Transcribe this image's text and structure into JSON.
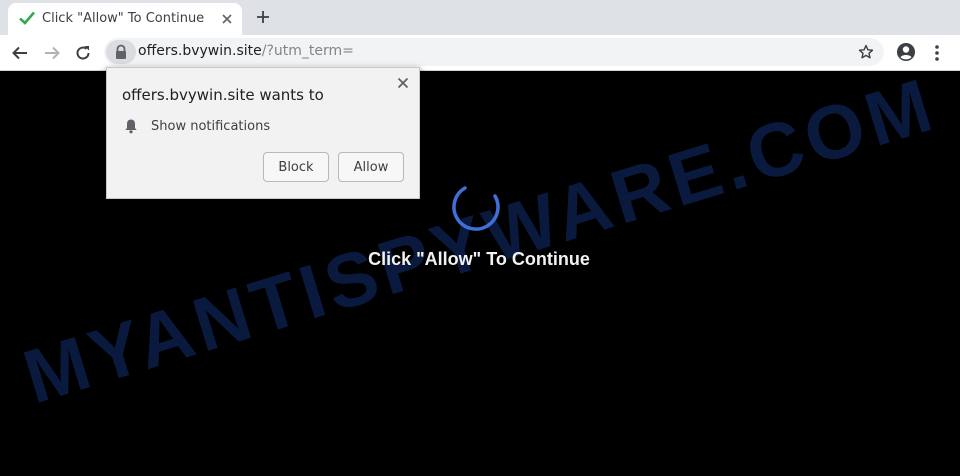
{
  "tab": {
    "title": "Click \"Allow\" To Continue",
    "favicon": "green-check-icon"
  },
  "toolbar": {
    "url_host": "offers.bvywin.site",
    "url_path": "/?utm_term=",
    "icons": [
      "back-arrow-icon",
      "forward-arrow-icon",
      "reload-icon",
      "lock-icon",
      "star-icon",
      "account-icon",
      "kebab-menu-icon"
    ]
  },
  "popup": {
    "title": "offers.bvywin.site wants to",
    "permission": "Show notifications",
    "block_label": "Block",
    "allow_label": "Allow"
  },
  "page": {
    "message": "Click \"Allow\" To Continue",
    "watermark": "MYANTISPYWARE.COM"
  },
  "colors": {
    "spinner": "#3f6fd8",
    "favicon_check": "#34a853",
    "background": "#000000"
  }
}
